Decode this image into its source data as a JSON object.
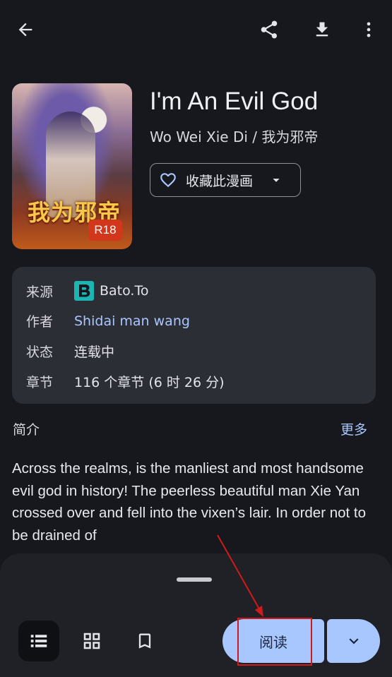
{
  "toolbar": {
    "back": "back",
    "share": "share",
    "download": "download",
    "more": "more"
  },
  "manga": {
    "title": "I'm An Evil God",
    "alt_title": "Wo Wei Xie Di / 我为邪帝",
    "cover_text": "我为邪帝",
    "rating_badge": "R18",
    "favorite_label": "收藏此漫画"
  },
  "info": {
    "rows": [
      {
        "key": "来源",
        "value": "Bato.To"
      },
      {
        "key": "作者",
        "value": "Shidai man wang"
      },
      {
        "key": "状态",
        "value": "连载中"
      },
      {
        "key": "章节",
        "value": "116 个章节 (6 时 26 分)"
      }
    ]
  },
  "intro": {
    "heading": "简介",
    "more": "更多",
    "text": "Across the realms, is the manliest and most handsome evil god in history! The peerless beautiful man Xie Yan crossed over and fell into the vixen’s lair. In order not to be drained of"
  },
  "bottom": {
    "read_label": "阅读"
  },
  "colors": {
    "accent": "#a9c7ff",
    "link": "#a9c6ff",
    "badge": "#d2371c",
    "highlight": "#d11a1a"
  }
}
